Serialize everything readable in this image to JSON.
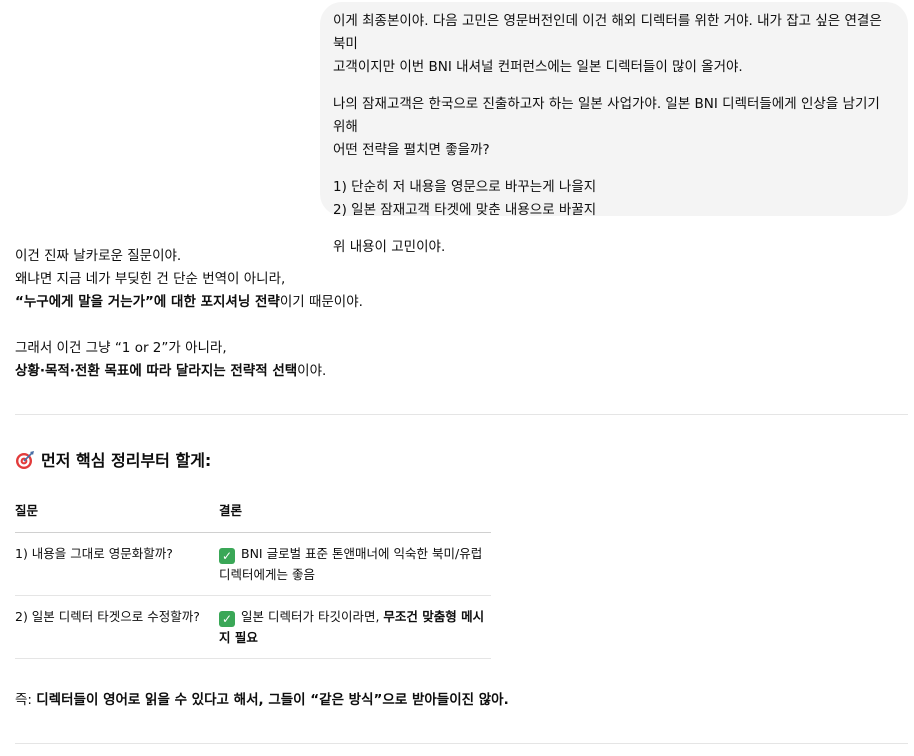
{
  "user_message": {
    "paragraphs": [
      {
        "line1": "이게 최종본이야. 다음 고민은 영문버전인데 이건 해외 디렉터를 위한 거야. 내가 잡고 싶은 연결은 북미",
        "line2": "고객이지만 이번 BNI 내셔널 컨퍼런스에는 일본 디렉터들이 많이 올거야."
      },
      {
        "line1": "나의 잠재고객은 한국으로 진출하고자 하는 일본 사업가야. 일본 BNI 디렉터들에게 인상을 남기기 위해",
        "line2": "어떤 전략을 펼치면 좋을까?"
      },
      {
        "line1": "1) 단순히 저 내용을 영문으로 바꾸는게 나을지",
        "line2": "2) 일본 잠재고객 타겟에 맞춘 내용으로 바꿀지"
      },
      {
        "line1": "위 내용이 고민이야."
      }
    ]
  },
  "assistant": {
    "intro": {
      "l1": "이건 진짜 날카로운 질문이야.",
      "l2": "왜냐면 지금 네가 부딪힌 건 단순 번역이 아니라,",
      "l3_bold": "“누구에게 말을 거는가”에 대한 포지셔닝 전략",
      "l3_rest": "이기 때문이야.",
      "l4": "그래서 이건 그냥 “1 or 2”가 아니라,",
      "l5_bold": "상황·목적·전환 목표에 따라 달라지는 전략적 선택",
      "l5_rest": "이야."
    },
    "section_heading": "먼저 핵심 정리부터 할게:",
    "section_icon": "direct-hit-icon",
    "table": {
      "headers": {
        "question": "질문",
        "conclusion": "결론"
      },
      "rows": [
        {
          "question": "1) 내용을 그대로 영문화할까?",
          "conclusion": "BNI 글로벌 표준 톤앤매너에 익숙한 북미/유럽 디렉터에게는 좋음"
        },
        {
          "question": "2) 일본 디렉터 타겟으로 수정할까?",
          "conclusion_plain": "일본 디렉터가 타깃이라면, ",
          "conclusion_bold": "무조건 맞춤형 메시지 필요"
        }
      ],
      "check_icon": "check-mark-icon"
    },
    "summary": {
      "prefix": "즉: ",
      "bold": "디렉터들이 영어로 읽을 수 있다고 해서, 그들이 “같은 방식”으로 받아들이진 않아."
    }
  },
  "colors": {
    "bubble": "#f4f4f4",
    "check": "#3aa757",
    "divider": "#e5e5e5"
  }
}
